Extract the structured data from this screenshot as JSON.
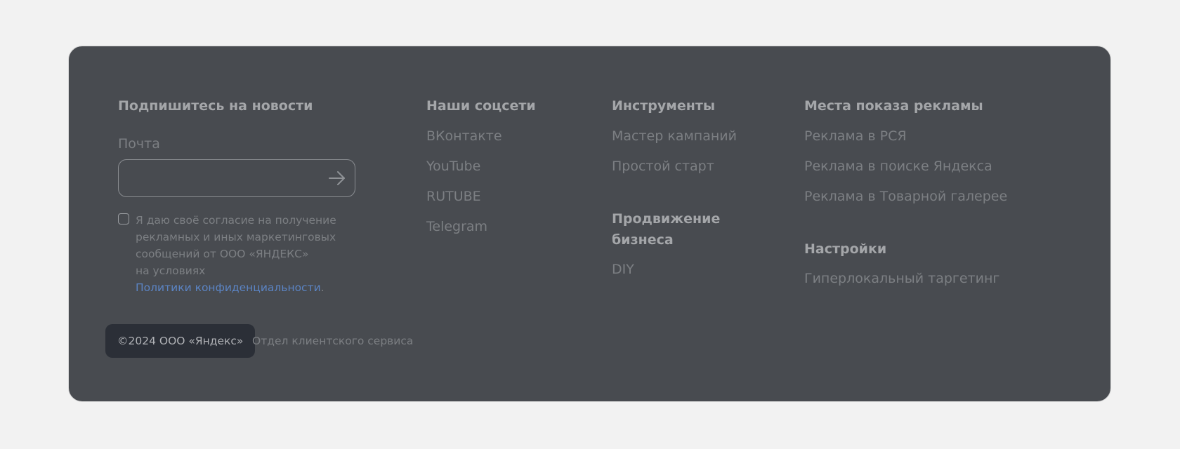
{
  "subscribe": {
    "heading": "Подпишитесь на новости",
    "email_label": "Почта",
    "email_value": "",
    "email_placeholder": "",
    "consent_lines": [
      "Я даю своё согласие на получение",
      "рекламных и иных маркетинговых",
      "сообщений от ООО «ЯНДЕКС»",
      "на условиях"
    ],
    "policy_link": "Политики конфиденциальности",
    "policy_suffix": "."
  },
  "social": {
    "heading": "Наши соцсети",
    "items": [
      "ВКонтакте",
      "YouTube",
      "RUTUBE",
      "Telegram"
    ]
  },
  "tools": {
    "heading": "Инструменты",
    "items": [
      "Мастер кампаний",
      "Простой старт"
    ]
  },
  "promotion": {
    "heading_lines": [
      "Продвижение",
      "бизнеса"
    ],
    "items": [
      "DIY"
    ]
  },
  "ad_places": {
    "heading": "Места показа рекламы",
    "items": [
      "Реклама в РСЯ",
      "Реклама в поиске Яндекса",
      "Реклама в Товарной галерее"
    ]
  },
  "settings": {
    "heading": "Настройки",
    "items": [
      "Гиперлокальный таргетинг"
    ]
  },
  "bottom": {
    "copyright": "©2024 ООО «Яндекс»",
    "service_link": "Отдел клиентского сервиса"
  },
  "colors": {
    "page_background": "#f2f2f2",
    "card_background": "#484b50",
    "heading_text": "#a4a6a9",
    "link_text": "#7c7f83",
    "policy_link": "#5b84c4",
    "copyright_background": "#2b2f37"
  },
  "icons": {
    "submit": "arrow-right-icon"
  }
}
